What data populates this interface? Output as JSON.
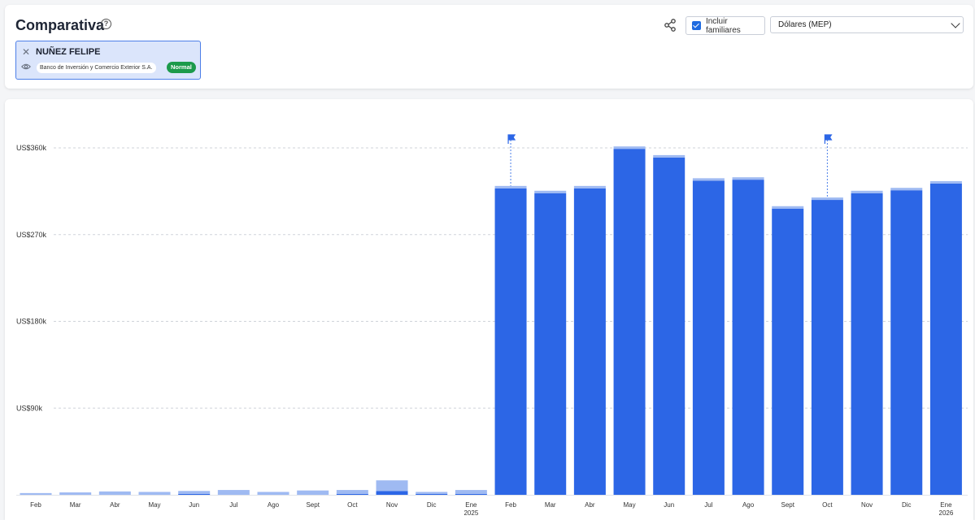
{
  "header": {
    "title": "Comparativa",
    "help_icon": "question-circle-icon",
    "share_icon": "share-icon",
    "include_family_label": "Incluir familiares",
    "include_family_checked": true,
    "currency_selected": "Dólares (MEP)"
  },
  "person": {
    "name": "NUÑEZ FELIPE",
    "bank": "Banco de Inversión y Comercio Exterior S.A.",
    "status": "Normal",
    "close_icon": "close-icon",
    "visibility_icon": "eye-icon"
  },
  "colors": {
    "primary_bar": "#2c66e6",
    "secondary_bar": "#9fbaf2",
    "badge": "#1c9a4b",
    "accent": "#1f6be0"
  },
  "chart_data": {
    "type": "bar",
    "stacked": true,
    "ylim": [
      0,
      360000
    ],
    "y_ticks": [
      90000,
      180000,
      270000,
      360000
    ],
    "y_tick_labels": [
      "US$90k",
      "US$180k",
      "US$270k",
      "US$360k"
    ],
    "grid": true,
    "categories": [
      {
        "label": "Feb",
        "year": ""
      },
      {
        "label": "Mar",
        "year": ""
      },
      {
        "label": "Abr",
        "year": ""
      },
      {
        "label": "May",
        "year": ""
      },
      {
        "label": "Jun",
        "year": ""
      },
      {
        "label": "Jul",
        "year": ""
      },
      {
        "label": "Ago",
        "year": ""
      },
      {
        "label": "Sept",
        "year": ""
      },
      {
        "label": "Oct",
        "year": ""
      },
      {
        "label": "Nov",
        "year": ""
      },
      {
        "label": "Dic",
        "year": ""
      },
      {
        "label": "Ene",
        "year": "2025"
      },
      {
        "label": "Feb",
        "year": ""
      },
      {
        "label": "Mar",
        "year": ""
      },
      {
        "label": "Abr",
        "year": ""
      },
      {
        "label": "May",
        "year": ""
      },
      {
        "label": "Jun",
        "year": ""
      },
      {
        "label": "Jul",
        "year": ""
      },
      {
        "label": "Ago",
        "year": ""
      },
      {
        "label": "Sept",
        "year": ""
      },
      {
        "label": "Oct",
        "year": ""
      },
      {
        "label": "Nov",
        "year": ""
      },
      {
        "label": "Dic",
        "year": ""
      },
      {
        "label": "Ene",
        "year": "2026"
      }
    ],
    "series": [
      {
        "values": [
          0,
          0,
          0,
          0,
          1000,
          0,
          0,
          0,
          1000,
          4000,
          1000,
          1000,
          318000,
          313000,
          318000,
          359000,
          350000,
          326000,
          327000,
          297000,
          306000,
          313000,
          316000,
          323000
        ]
      },
      {
        "values": [
          1800,
          2500,
          3500,
          3000,
          3000,
          5000,
          3000,
          4500,
          4000,
          11000,
          2000,
          4000,
          2500,
          2500,
          2500,
          2500,
          2500,
          2500,
          2500,
          2500,
          2500,
          2500,
          2500,
          2500
        ]
      }
    ],
    "flags": [
      {
        "category_index": 12,
        "icon": "flag-icon"
      },
      {
        "category_index": 20,
        "icon": "flag-icon"
      }
    ]
  }
}
